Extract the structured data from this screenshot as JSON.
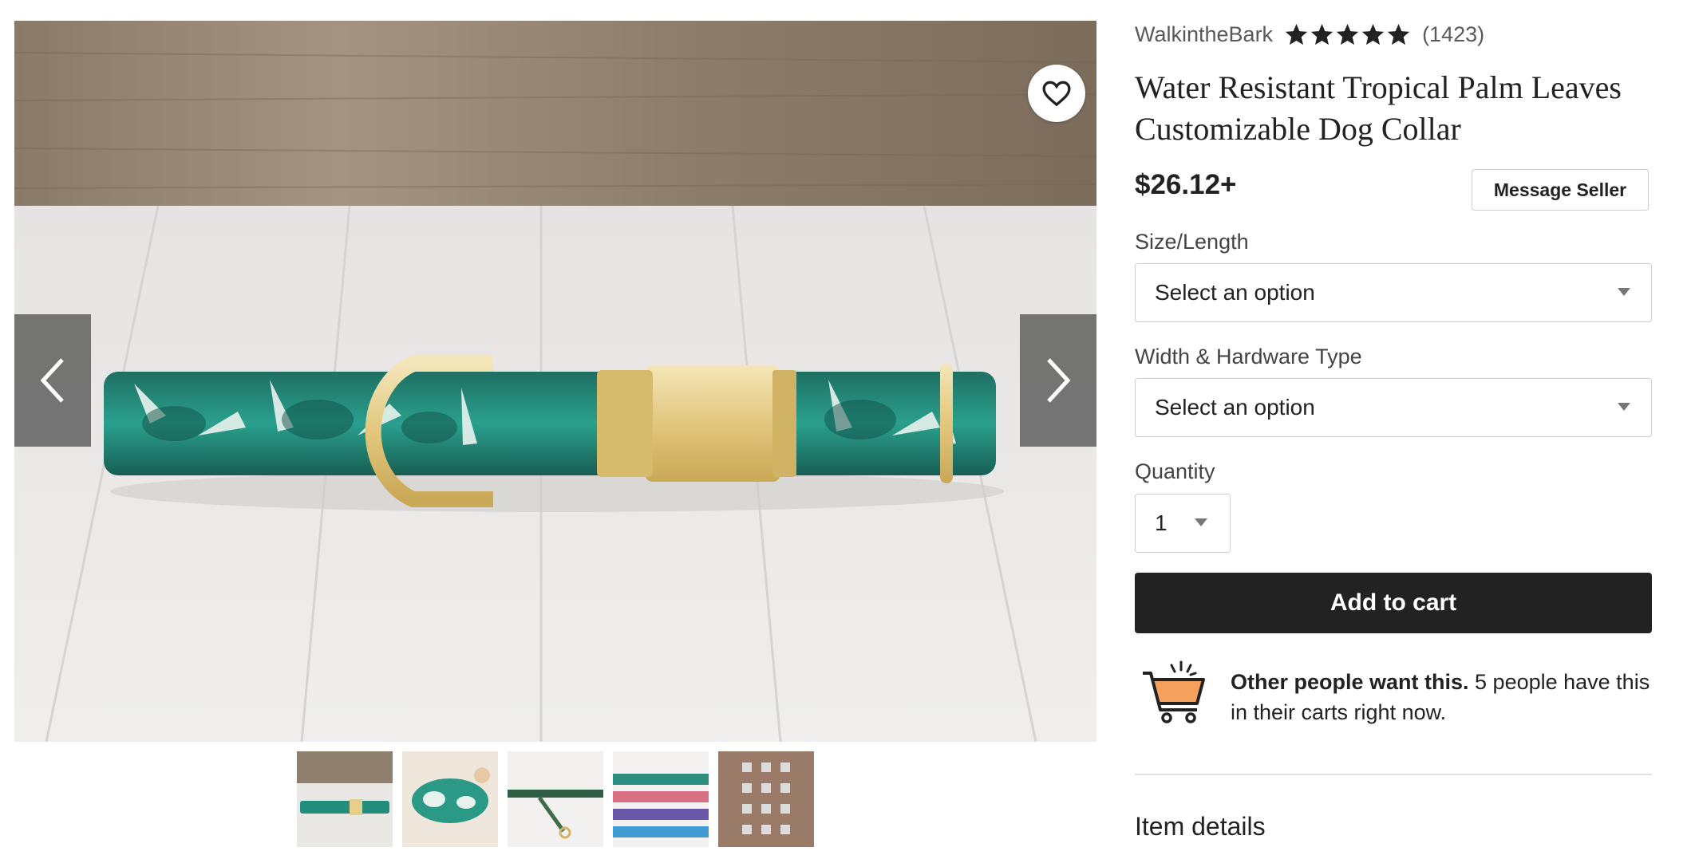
{
  "gallery": {
    "thumbnails": [
      "thumb-1",
      "thumb-2",
      "thumb-3",
      "thumb-4",
      "thumb-5"
    ]
  },
  "listing": {
    "shop_name": "WalkintheBark",
    "rating_stars": 5,
    "review_count": "(1423)",
    "title": "Water Resistant Tropical Palm Leaves Customizable Dog Collar",
    "price": "$26.12+",
    "message_seller_label": "Message Seller"
  },
  "options": {
    "size_label": "Size/Length",
    "size_value": "Select an option",
    "width_label": "Width & Hardware Type",
    "width_value": "Select an option",
    "quantity_label": "Quantity",
    "quantity_value": "1"
  },
  "cart": {
    "add_label": "Add to cart",
    "demand_bold": "Other people want this.",
    "demand_rest": " 5 people have this in their carts right now."
  },
  "details": {
    "heading": "Item details"
  },
  "colors": {
    "button_dark": "#222222",
    "cart_accent": "#f5a05d",
    "star": "#222222"
  }
}
